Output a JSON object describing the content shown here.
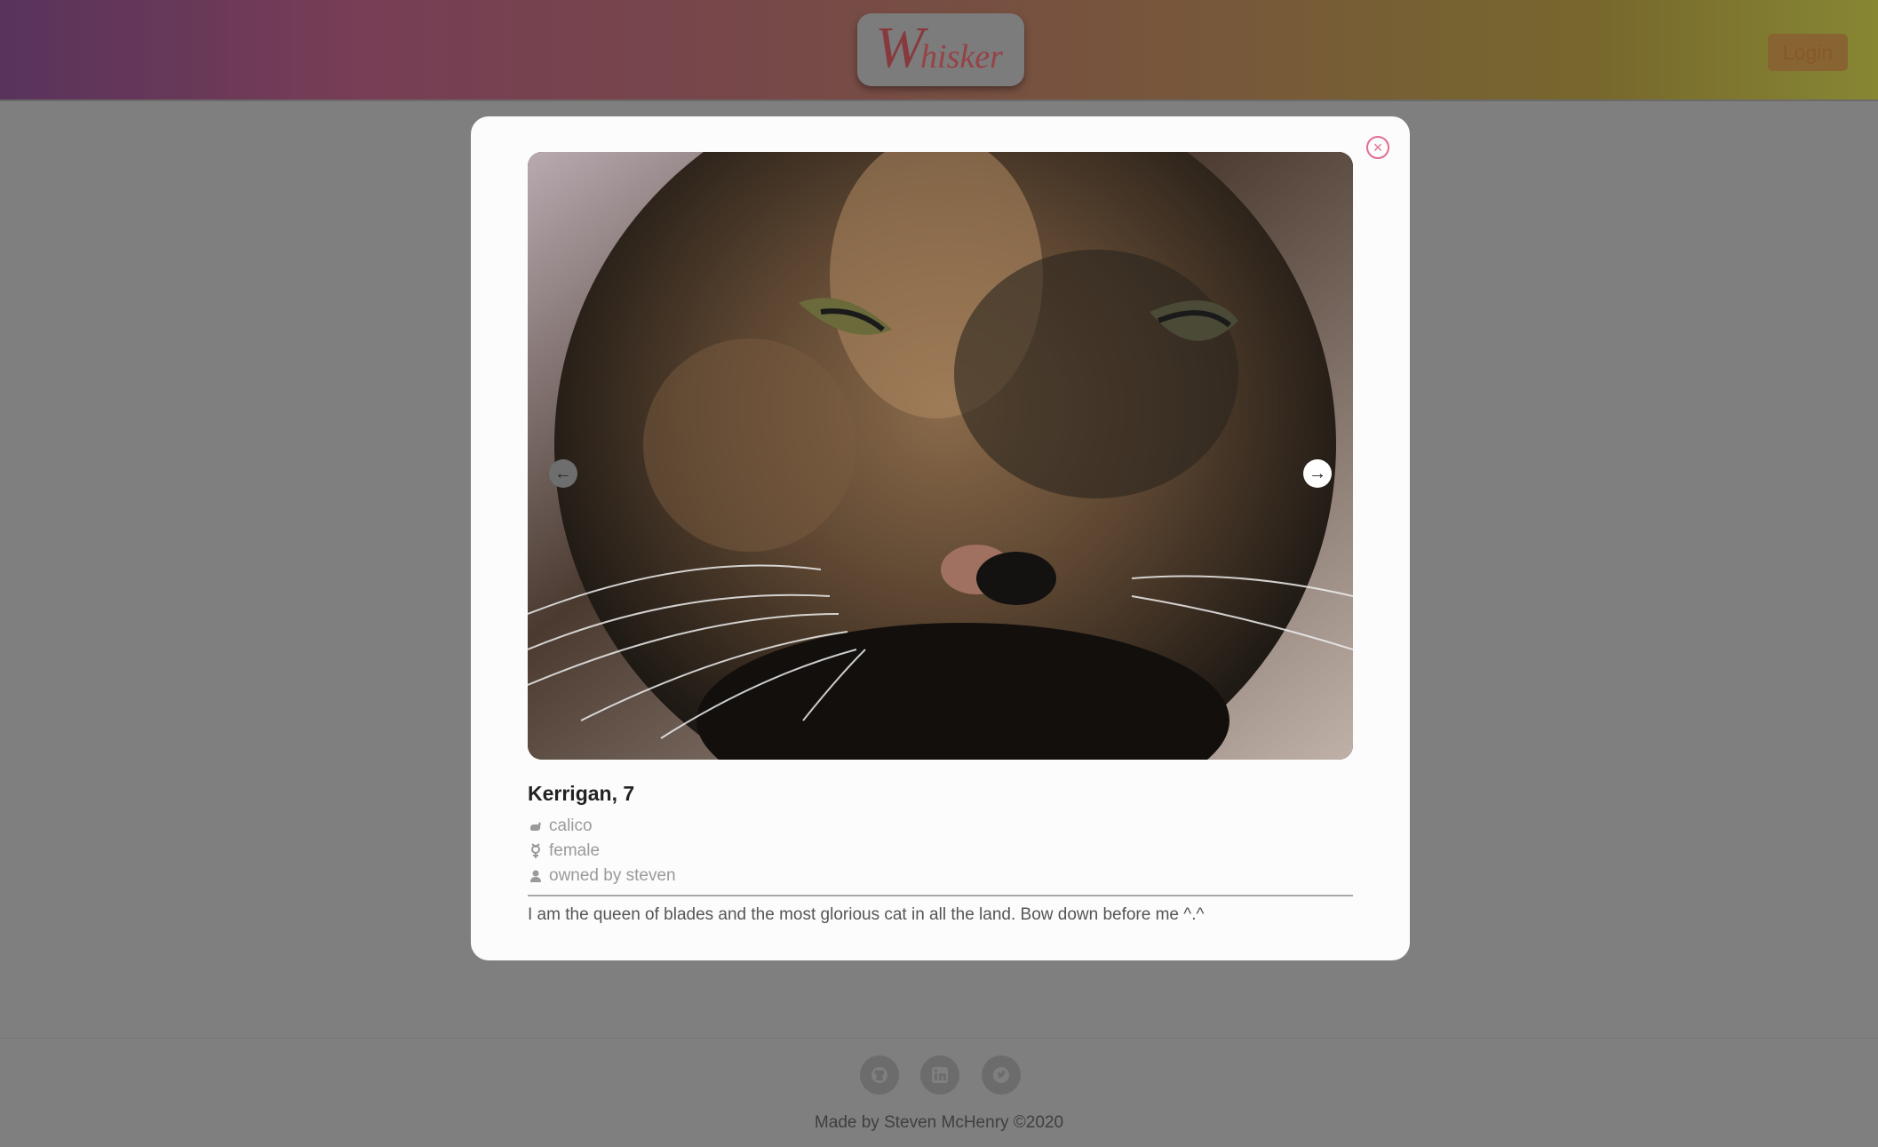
{
  "header": {
    "logo_initial": "W",
    "logo_rest": "hisker",
    "login_label": "Login"
  },
  "modal": {
    "close_symbol": "×",
    "carousel": {
      "prev_symbol": "←",
      "next_symbol": "→"
    },
    "cat": {
      "name_age": "Kerrigan, 7",
      "breed": "calico",
      "sex": "female",
      "owner": "owned by steven",
      "bio": "I am the queen of blades and the most glorious cat in all the land. Bow down before me ^.^"
    },
    "icons": {
      "breed": "cat-icon",
      "sex": "gender-icon",
      "owner": "user-icon"
    }
  },
  "footer": {
    "social": [
      "github-icon",
      "linkedin-icon",
      "twitter-icon"
    ],
    "credit": "Made by Steven McHenry ©2020"
  },
  "colors": {
    "accent_close": "#e36c8f",
    "overlay": "#7f7f7f",
    "modal_bg": "#fcfcfc"
  }
}
